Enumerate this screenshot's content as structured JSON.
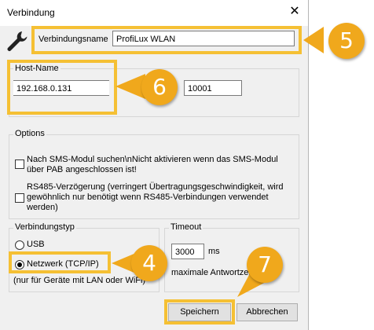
{
  "window": {
    "title": "Verbindung",
    "close_icon": "close-icon"
  },
  "connection_name": {
    "label": "Verbindungsname",
    "value": "ProfiLux WLAN"
  },
  "host": {
    "label": "Host-Name",
    "address": "192.168.0.131",
    "port": "10001"
  },
  "options": {
    "label": "Options",
    "sms_module": "Nach SMS-Modul suchen\\nNicht aktivieren wenn das SMS-Modul über PAB angeschlossen ist!",
    "rs485_delay": "RS485-Verzögerung (verringert Übertragungsgeschwindigkeit, wird gewöhnlich nur benötigt wenn RS485-Verbindungen verwendet werden)"
  },
  "connection_type": {
    "label": "Verbindungstyp",
    "usb": "USB",
    "network": "Netzwerk (TCP/IP)",
    "network_note": "(nur für Geräte mit LAN oder WiFi)",
    "selected": "Netzwerk (TCP/IP)"
  },
  "timeout": {
    "label": "Timeout",
    "value": "3000",
    "unit": "ms",
    "max_response": "maximale Antwortzeit"
  },
  "buttons": {
    "save": "Speichern",
    "cancel": "Abbrechen"
  },
  "callouts": {
    "c5": "5",
    "c6": "6",
    "c4": "4",
    "c7": "7"
  },
  "colors": {
    "highlight": "#f5c034",
    "callout": "#f0a81c",
    "dialog_bg": "#f0f0f0"
  }
}
